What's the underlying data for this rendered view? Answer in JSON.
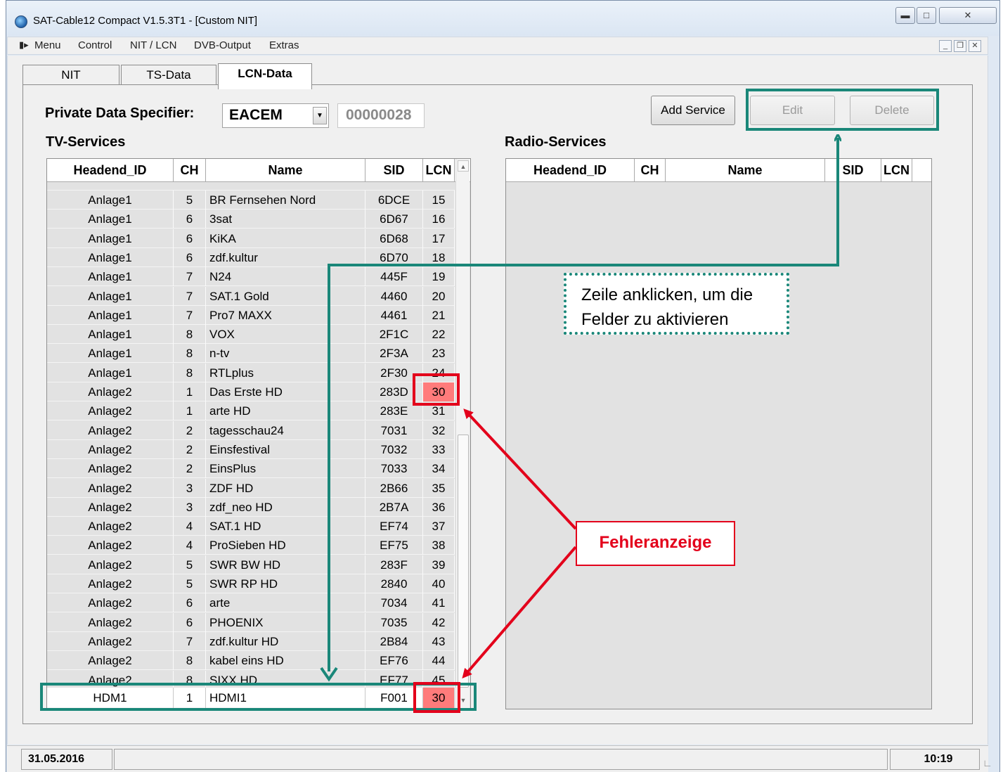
{
  "window": {
    "title": "SAT-Cable12 Compact V1.5.3T1 - [Custom NIT]",
    "caption_buttons": [
      "minimize",
      "maximize",
      "close"
    ]
  },
  "menu": [
    "Menu",
    "Control",
    "NIT / LCN",
    "DVB-Output",
    "Extras"
  ],
  "tabs": [
    {
      "label": "NIT",
      "active": false
    },
    {
      "label": "TS-Data",
      "active": false
    },
    {
      "label": "LCN-Data",
      "active": true
    }
  ],
  "private_data_specifier": {
    "label": "Private Data Specifier:",
    "selected": "EACEM",
    "code": "00000028"
  },
  "buttons": {
    "add": "Add Service",
    "edit": "Edit",
    "delete": "Delete"
  },
  "tv_services": {
    "title": "TV-Services",
    "columns": [
      "Headend_ID",
      "CH",
      "Name",
      "SID",
      "LCN"
    ],
    "rows": [
      {
        "id": "Anlage1",
        "ch": "5",
        "name": "BR Fernsehen Nord",
        "sid": "6DCE",
        "lcn": "15",
        "error": false
      },
      {
        "id": "Anlage1",
        "ch": "6",
        "name": "3sat",
        "sid": "6D67",
        "lcn": "16",
        "error": false
      },
      {
        "id": "Anlage1",
        "ch": "6",
        "name": "KiKA",
        "sid": "6D68",
        "lcn": "17",
        "error": false
      },
      {
        "id": "Anlage1",
        "ch": "6",
        "name": "zdf.kultur",
        "sid": "6D70",
        "lcn": "18",
        "error": false
      },
      {
        "id": "Anlage1",
        "ch": "7",
        "name": "N24",
        "sid": "445F",
        "lcn": "19",
        "error": false
      },
      {
        "id": "Anlage1",
        "ch": "7",
        "name": "SAT.1 Gold",
        "sid": "4460",
        "lcn": "20",
        "error": false
      },
      {
        "id": "Anlage1",
        "ch": "7",
        "name": "Pro7 MAXX",
        "sid": "4461",
        "lcn": "21",
        "error": false
      },
      {
        "id": "Anlage1",
        "ch": "8",
        "name": "VOX",
        "sid": "2F1C",
        "lcn": "22",
        "error": false
      },
      {
        "id": "Anlage1",
        "ch": "8",
        "name": "n-tv",
        "sid": "2F3A",
        "lcn": "23",
        "error": false
      },
      {
        "id": "Anlage1",
        "ch": "8",
        "name": "RTLplus",
        "sid": "2F30",
        "lcn": "24",
        "error": false
      },
      {
        "id": "Anlage2",
        "ch": "1",
        "name": "Das Erste HD",
        "sid": "283D",
        "lcn": "30",
        "error": true
      },
      {
        "id": "Anlage2",
        "ch": "1",
        "name": "arte HD",
        "sid": "283E",
        "lcn": "31",
        "error": false
      },
      {
        "id": "Anlage2",
        "ch": "2",
        "name": "tagesschau24",
        "sid": "7031",
        "lcn": "32",
        "error": false
      },
      {
        "id": "Anlage2",
        "ch": "2",
        "name": "Einsfestival",
        "sid": "7032",
        "lcn": "33",
        "error": false
      },
      {
        "id": "Anlage2",
        "ch": "2",
        "name": "EinsPlus",
        "sid": "7033",
        "lcn": "34",
        "error": false
      },
      {
        "id": "Anlage2",
        "ch": "3",
        "name": "ZDF HD",
        "sid": "2B66",
        "lcn": "35",
        "error": false
      },
      {
        "id": "Anlage2",
        "ch": "3",
        "name": "zdf_neo HD",
        "sid": "2B7A",
        "lcn": "36",
        "error": false
      },
      {
        "id": "Anlage2",
        "ch": "4",
        "name": "SAT.1 HD",
        "sid": "EF74",
        "lcn": "37",
        "error": false
      },
      {
        "id": "Anlage2",
        "ch": "4",
        "name": "ProSieben HD",
        "sid": "EF75",
        "lcn": "38",
        "error": false
      },
      {
        "id": "Anlage2",
        "ch": "5",
        "name": "SWR BW HD",
        "sid": "283F",
        "lcn": "39",
        "error": false
      },
      {
        "id": "Anlage2",
        "ch": "5",
        "name": "SWR RP HD",
        "sid": "2840",
        "lcn": "40",
        "error": false
      },
      {
        "id": "Anlage2",
        "ch": "6",
        "name": "arte",
        "sid": "7034",
        "lcn": "41",
        "error": false
      },
      {
        "id": "Anlage2",
        "ch": "6",
        "name": "PHOENIX",
        "sid": "7035",
        "lcn": "42",
        "error": false
      },
      {
        "id": "Anlage2",
        "ch": "7",
        "name": "zdf.kultur HD",
        "sid": "2B84",
        "lcn": "43",
        "error": false
      },
      {
        "id": "Anlage2",
        "ch": "8",
        "name": "kabel eins HD",
        "sid": "EF76",
        "lcn": "44",
        "error": false
      },
      {
        "id": "Anlage2",
        "ch": "8",
        "name": "SIXX HD",
        "sid": "EF77",
        "lcn": "45",
        "error": false
      }
    ],
    "new_row": {
      "id": "HDM1",
      "ch": "1",
      "name": "HDMI1",
      "sid": "F001",
      "lcn": "30",
      "error": true
    }
  },
  "radio_services": {
    "title": "Radio-Services",
    "columns": [
      "Headend_ID",
      "CH",
      "Name",
      "SID",
      "LCN"
    ]
  },
  "annotations": {
    "note": [
      "Zeile anklicken, um die",
      "Felder zu aktivieren"
    ],
    "error_label": "Fehleranzeige"
  },
  "status": {
    "date": "31.05.2016",
    "time": "10:19"
  },
  "colors": {
    "teal": "#1a8779",
    "red": "#e3001b",
    "error_fill": "#ff7b7b"
  }
}
